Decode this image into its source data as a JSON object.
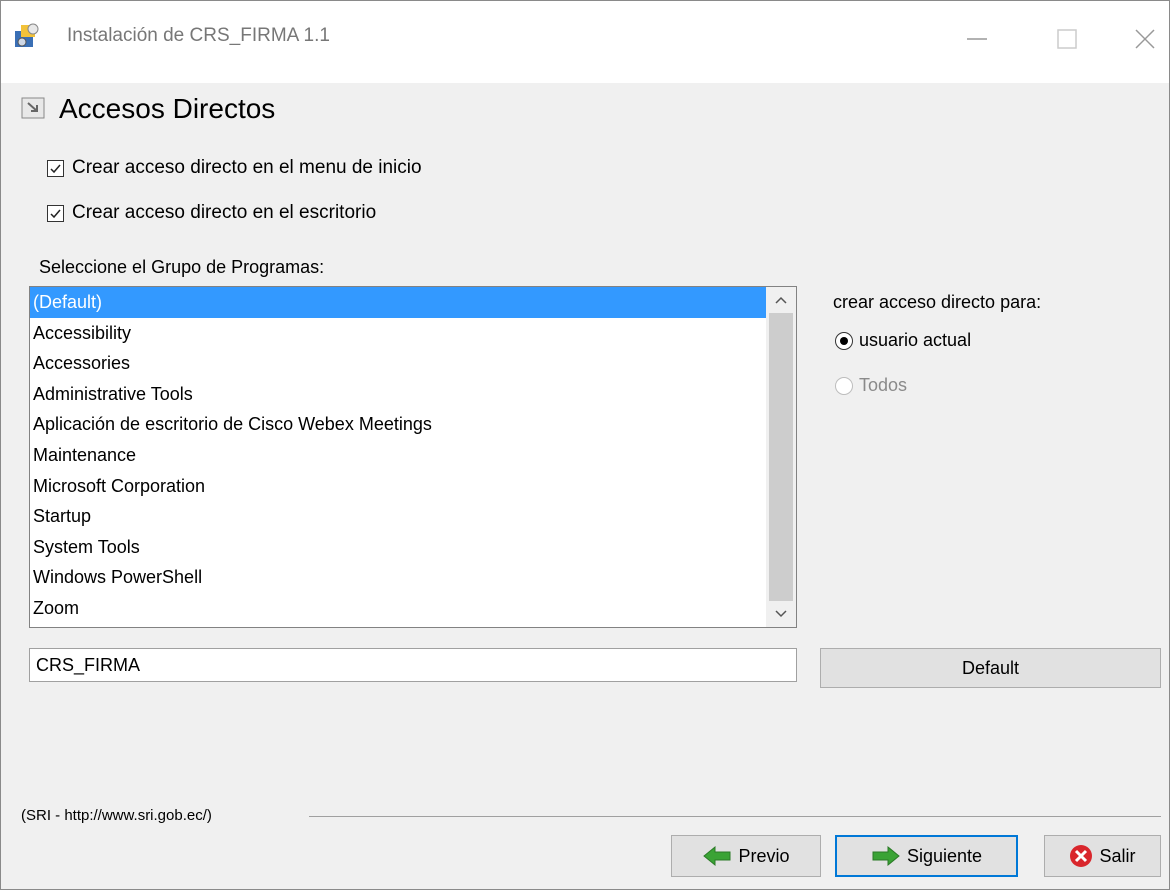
{
  "window": {
    "title": "Instalación de CRS_FIRMA 1.1"
  },
  "section": {
    "title": "Accesos Directos"
  },
  "checkboxes": [
    {
      "label": "Crear acceso directo en el menu de inicio",
      "checked": true
    },
    {
      "label": "Crear acceso directo en el escritorio",
      "checked": true
    }
  ],
  "program_group": {
    "label": "Seleccione el Grupo de Programas:",
    "items": [
      "(Default)",
      "Accessibility",
      "Accessories",
      "Administrative Tools",
      "Aplicación de escritorio de Cisco Webex Meetings",
      "Maintenance",
      "Microsoft Corporation",
      "Startup",
      "System Tools",
      "Windows PowerShell",
      "Zoom"
    ],
    "selected_index": 0,
    "input_value": "CRS_FIRMA",
    "default_button": "Default"
  },
  "shortcut_for": {
    "label": "crear acceso directo para:",
    "options": [
      {
        "label": "usuario actual",
        "selected": true,
        "enabled": true
      },
      {
        "label": "Todos",
        "selected": false,
        "enabled": false
      }
    ]
  },
  "footer": {
    "text": "(SRI - http://www.sri.gob.ec/)"
  },
  "buttons": {
    "prev": "Previo",
    "next": "Siguiente",
    "exit": "Salir"
  },
  "colors": {
    "selection": "#3399ff",
    "focus_border": "#0078d7",
    "exit_icon": "#d9262c",
    "arrow_icon": "#3aa335"
  }
}
